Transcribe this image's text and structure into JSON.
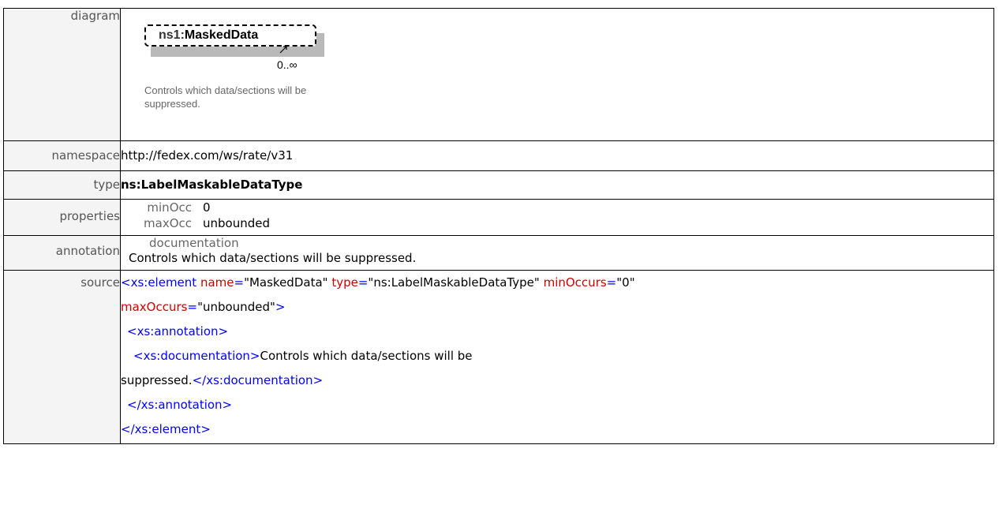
{
  "labels": {
    "diagram": "diagram",
    "namespace": "namespace",
    "type": "type",
    "properties": "properties",
    "annotation": "annotation",
    "source": "source"
  },
  "diagram": {
    "prefix": "ns1:",
    "element_name": "MaskedData",
    "occurrence": "0..∞",
    "note": "Controls which data/sections will be suppressed."
  },
  "namespace": "http://fedex.com/ws/rate/v31",
  "type": "ns:LabelMaskableDataType",
  "properties": {
    "min_label": "minOcc",
    "min_value": "0",
    "max_label": "maxOcc",
    "max_value": "unbounded"
  },
  "annotation": {
    "doc_label": "documentation",
    "doc_text": "Controls which data/sections will be suppressed."
  },
  "source": {
    "open_tag": "<xs:element",
    "attr_name": "name",
    "attr_name_val": "\"MaskedData\"",
    "attr_type": "type",
    "attr_type_val": "\"ns:LabelMaskableDataType\"",
    "attr_min": "minOccurs",
    "attr_min_val": "\"0\"",
    "attr_max": "maxOccurs",
    "attr_max_val": "\"unbounded\"",
    "close_bracket": ">",
    "eq": "=",
    "annotation_open": "<xs:annotation>",
    "documentation_open": "<xs:documentation>",
    "documentation_text_1": "Controls which data/sections will be",
    "documentation_text_2": "suppressed.",
    "documentation_close": "</xs:documentation>",
    "annotation_close": "</xs:annotation>",
    "element_close": "</xs:element>"
  },
  "colors": {
    "title": "#4a1a9c",
    "tag": "#0000ff",
    "attribute": "#cc0000",
    "label_bg": "#f4f4f4"
  }
}
